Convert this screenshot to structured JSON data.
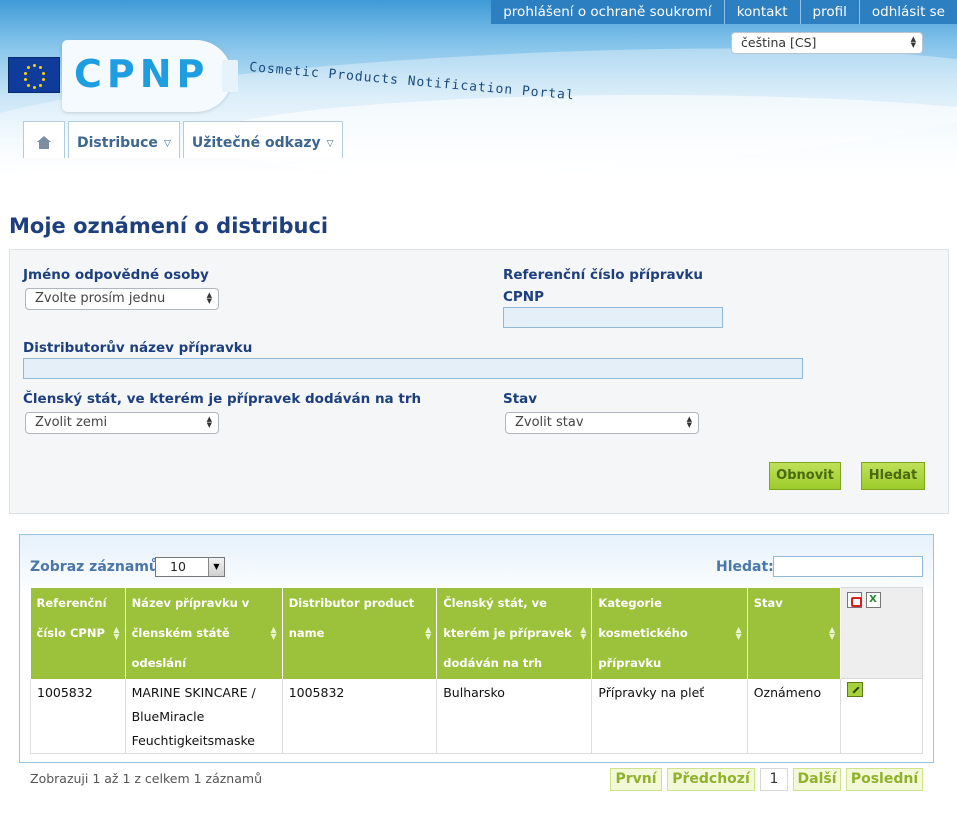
{
  "topnav": {
    "privacy": "prohlášení o ochraně soukromí",
    "contact": "kontakt",
    "profile": "profil",
    "logout": "odhlásit se"
  },
  "language": {
    "selected": "čeština [CS]"
  },
  "brand": {
    "logo_text": "CPNP",
    "tagline": "Cosmetic Products Notification Portal"
  },
  "mainnav": {
    "home_icon": "home-icon",
    "tabs": [
      {
        "label": "Distribuce"
      },
      {
        "label": "Užitečné odkazy"
      }
    ]
  },
  "page": {
    "title": "Moje oznámení o distribuci"
  },
  "filter": {
    "responsible_person_label": "Jméno odpovědné osoby",
    "responsible_person_value": "Zvolte prosím jednu",
    "reference_label": "Referenční číslo přípravku",
    "cpnp_label": "CPNP",
    "cpnp_value": "",
    "distributor_name_label": "Distributorův název přípravku",
    "distributor_name_value": "",
    "member_state_label": "Členský stát, ve kterém je přípravek dodáván na trh",
    "member_state_value": "Zvolit zemi",
    "status_label": "Stav",
    "status_value": "Zvolit stav",
    "refresh_button": "Obnovit",
    "search_button": "Hledat"
  },
  "results": {
    "show_records_label": "Zobraz záznamů",
    "page_size": "10",
    "search_label": "Hledat:",
    "search_value": "",
    "columns": [
      "Referenční číslo CPNP",
      "Název přípravku v členském státě odeslání",
      "Distributor product name",
      "Členský stát, ve kterém je přípravek dodáván na trh",
      "Kategorie kosmetického přípravku",
      "Stav"
    ],
    "rows": [
      {
        "reference": "1005832",
        "product_name": "MARINE SKINCARE / BlueMiracle Feuchtigkeitsmaske",
        "distributor_product_name": "1005832",
        "member_state": "Bulharsko",
        "category": "Přípravky na pleť",
        "status": "Oznámeno"
      }
    ],
    "info": "Zobrazuji 1 až 1 z celkem 1 záznamů",
    "pagination": {
      "first": "První",
      "previous": "Předchozí",
      "current": "1",
      "next": "Další",
      "last": "Poslední"
    }
  },
  "colors": {
    "accent_green": "#9cc13a",
    "title_blue": "#1d3f7e",
    "header_blue": "#2c7fc1"
  }
}
